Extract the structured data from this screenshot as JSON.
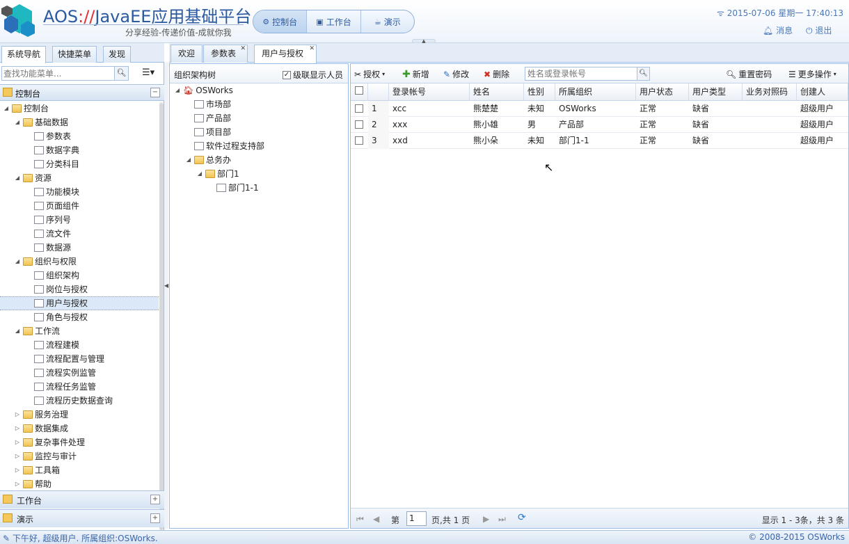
{
  "header": {
    "title_main": "AOS",
    "title_slashes": "://",
    "title_rest": "JavaEE应用基础平台",
    "subtitle": "分享经验-传递价值-成就你我",
    "nav": [
      "控制台",
      "工作台",
      "演示"
    ],
    "datetime": "2015-07-06 星期一 17:40:13",
    "messages": "消息",
    "logout": "退出"
  },
  "left": {
    "tabs": [
      "系统导航",
      "快捷菜单",
      "发现"
    ],
    "search_placeholder": "查找功能菜单...",
    "accordion_title": "控制台",
    "tree": [
      {
        "label": "控制台"
      },
      {
        "label": "基础数据"
      },
      {
        "label": "参数表"
      },
      {
        "label": "数据字典"
      },
      {
        "label": "分类科目"
      },
      {
        "label": "资源"
      },
      {
        "label": "功能模块"
      },
      {
        "label": "页面组件"
      },
      {
        "label": "序列号"
      },
      {
        "label": "流文件"
      },
      {
        "label": "数据源"
      },
      {
        "label": "组织与权限"
      },
      {
        "label": "组织架构"
      },
      {
        "label": "岗位与授权"
      },
      {
        "label": "用户与授权"
      },
      {
        "label": "角色与授权"
      },
      {
        "label": "工作流"
      },
      {
        "label": "流程建模"
      },
      {
        "label": "流程配置与管理"
      },
      {
        "label": "流程实例监管"
      },
      {
        "label": "流程任务监管"
      },
      {
        "label": "流程历史数据查询"
      },
      {
        "label": "服务治理"
      },
      {
        "label": "数据集成"
      },
      {
        "label": "复杂事件处理"
      },
      {
        "label": "监控与审计"
      },
      {
        "label": "工具箱"
      },
      {
        "label": "帮助"
      }
    ],
    "bottom_accordions": [
      "工作台",
      "演示"
    ]
  },
  "main_tabs": [
    "欢迎",
    "参数表",
    "用户与授权"
  ],
  "org": {
    "title": "组织架构树",
    "cascade_label": "级联显示人员",
    "tree": [
      "OSWorks",
      "市场部",
      "产品部",
      "项目部",
      "软件过程支持部",
      "总务办",
      "部门1",
      "部门1-1"
    ]
  },
  "grid": {
    "toolbar": {
      "authorize": "授权",
      "add": "新增",
      "edit": "修改",
      "delete": "删除",
      "search_placeholder": "姓名或登录帐号",
      "reset_password": "重置密码",
      "more": "更多操作"
    },
    "columns": [
      "登录帐号",
      "姓名",
      "性别",
      "所属组织",
      "用户状态",
      "用户类型",
      "业务对照码",
      "创建人"
    ],
    "rows": [
      {
        "n": "1",
        "account": "xcc",
        "name": "熊楚楚",
        "gender": "未知",
        "org": "OSWorks",
        "status": "正常",
        "type": "缺省",
        "code": "",
        "creator": "超级用户"
      },
      {
        "n": "2",
        "account": "xxx",
        "name": "熊小雄",
        "gender": "男",
        "org": "产品部",
        "status": "正常",
        "type": "缺省",
        "code": "",
        "creator": "超级用户"
      },
      {
        "n": "3",
        "account": "xxd",
        "name": "熊小朵",
        "gender": "未知",
        "org": "部门1-1",
        "status": "正常",
        "type": "缺省",
        "code": "",
        "creator": "超级用户"
      }
    ],
    "pager": {
      "page_prefix": "第",
      "page": "1",
      "page_suffix": "页,共 1 页",
      "summary": "显示 1 - 3条，共 3 条"
    }
  },
  "status": {
    "left": "下午好, 超级用户. 所属组织:OSWorks.",
    "right": "© 2008-2015 OSWorks"
  },
  "colors": {
    "accent": "#2c5aa0",
    "border": "#99bbe8"
  }
}
